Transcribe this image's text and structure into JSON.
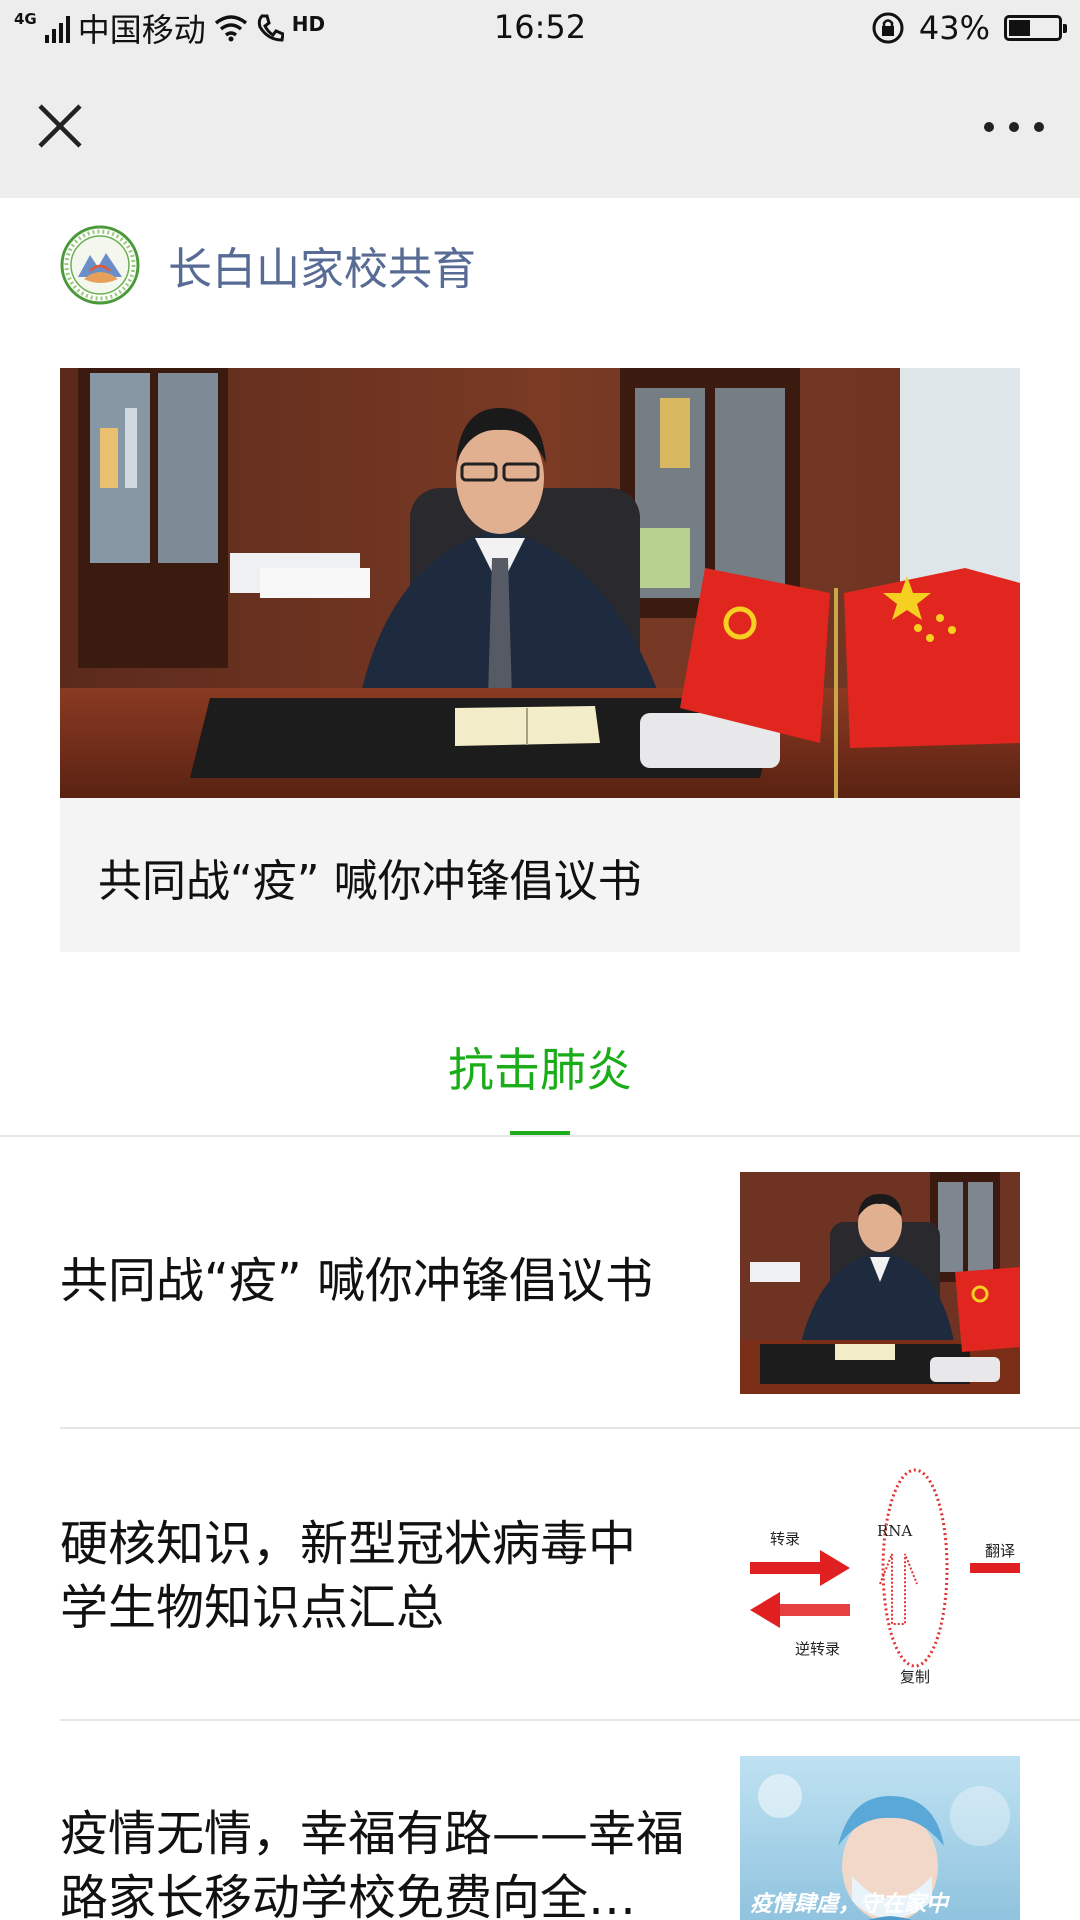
{
  "status_bar": {
    "network": "4G",
    "carrier": "中国移动",
    "hd": "HD",
    "time": "16:52",
    "battery_percent": "43%",
    "battery_level": 0.43
  },
  "nav": {
    "close_icon": "close-icon",
    "more_icon": "more-icon"
  },
  "account": {
    "name": "长白山家校共育",
    "logo_icon": "account-logo-icon"
  },
  "hero": {
    "title": "共同战“疫” 喊你冲锋倡议书"
  },
  "tab": {
    "label": "抗击肺炎",
    "color": "#1aad19"
  },
  "articles": [
    {
      "title": "共同战“疫” 喊你冲锋倡议书"
    },
    {
      "title_line1": "硬核知识，新型冠状病毒中",
      "title_line2": "学生物知识点汇总"
    },
    {
      "title_line1": "疫情无情，幸福有路——幸福",
      "title_line2": "路家长移动学校免费向全…"
    }
  ],
  "diagram": {
    "transcription": "转录",
    "reverse_transcription": "逆转录",
    "rna": "RNA",
    "translation": "翻译",
    "replication": "复制"
  },
  "thumb3_caption": "疫情肆虐，守在家中"
}
